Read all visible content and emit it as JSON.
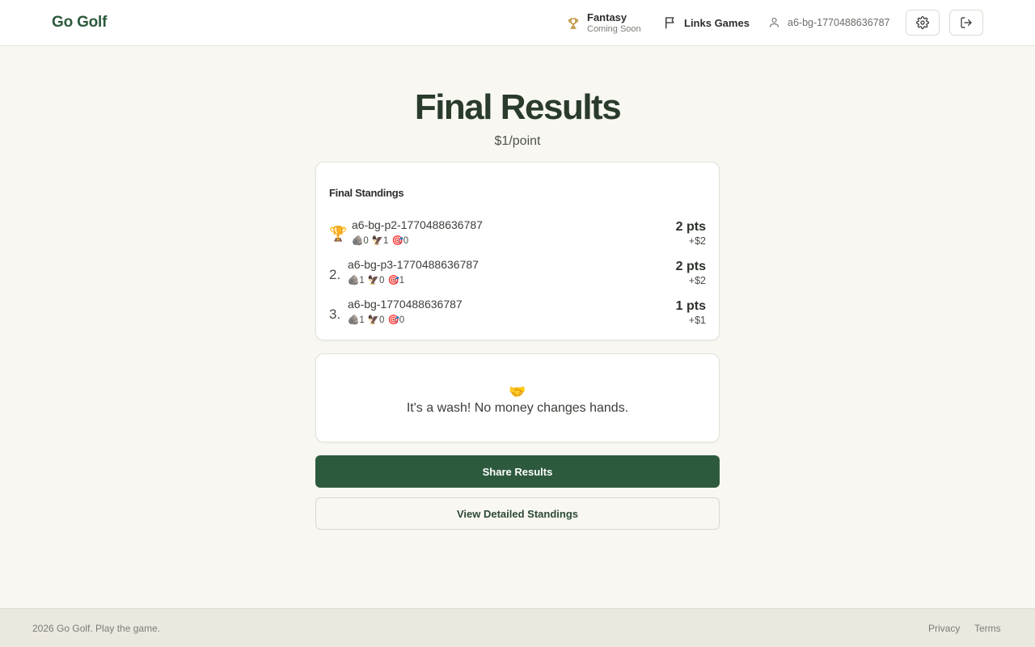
{
  "header": {
    "brand": "Go Golf",
    "fantasy": {
      "title": "Fantasy",
      "subtitle": "Coming Soon",
      "icon": "trophy-icon"
    },
    "links_games": {
      "label": "Links Games",
      "icon": "flag-icon"
    },
    "user": {
      "name": "a6-bg-1770488636787",
      "icon": "user-icon"
    },
    "settings_icon": "gear-icon",
    "logout_icon": "logout-icon"
  },
  "main": {
    "title": "Final Results",
    "subtitle": "$1/point",
    "standings": {
      "title": "Final Standings",
      "rows": [
        {
          "rank": "",
          "trophy": "🏆",
          "name": "a6-bg-p2-1770488636787",
          "stat1": "🪨0",
          "stat2": "🦅1",
          "stat3": "🎯0",
          "points": "2 pts",
          "money": "+$2"
        },
        {
          "rank": "2.",
          "name": "a6-bg-p3-1770488636787",
          "stat1": "🪨1",
          "stat2": "🦅0",
          "stat3": "🎯1",
          "points": "2 pts",
          "money": "+$2"
        },
        {
          "rank": "3.",
          "name": "a6-bg-1770488636787",
          "stat1": "🪨1",
          "stat2": "🦅0",
          "stat3": "🎯0",
          "points": "1 pts",
          "money": "+$1"
        }
      ]
    },
    "wash": {
      "emoji": "🤝",
      "text": "It's a wash! No money changes hands."
    },
    "share_button": "Share Results",
    "detailed_button": "View Detailed Standings"
  },
  "footer": {
    "copyright": "2026 Go Golf. Play the game.",
    "privacy": "Privacy",
    "terms": "Terms"
  },
  "colors": {
    "brand_green": "#2c5a3c",
    "button_green": "#2d5a3d",
    "background": "#f8f7f2",
    "trophy_gold": "#b8862b"
  }
}
